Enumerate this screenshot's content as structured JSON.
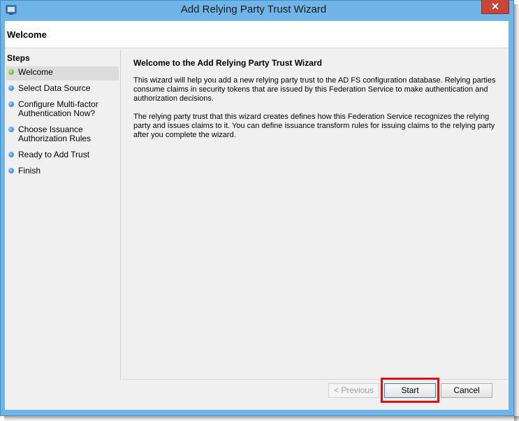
{
  "window": {
    "title": "Add Relying Party Trust Wizard",
    "close_glyph": "✕"
  },
  "header": {
    "title": "Welcome"
  },
  "steps": {
    "title": "Steps",
    "items": [
      {
        "label": "Welcome",
        "status": "current"
      },
      {
        "label": "Select Data Source",
        "status": "pending"
      },
      {
        "label": "Configure Multi-factor\nAuthentication Now?",
        "status": "pending"
      },
      {
        "label": "Choose Issuance\nAuthorization Rules",
        "status": "pending"
      },
      {
        "label": "Ready to Add Trust",
        "status": "pending"
      },
      {
        "label": "Finish",
        "status": "pending"
      }
    ]
  },
  "main": {
    "title": "Welcome to the Add Relying Party Trust Wizard",
    "paragraph1": "This wizard will help you add a new relying party trust to the AD FS configuration database.  Relying parties consume claims in security tokens that are issued by this Federation Service to make authentication and authorization decisions.",
    "paragraph2": "The relying party trust that this wizard creates defines how this Federation Service recognizes the relying party and issues claims to it. You can define issuance transform rules for issuing claims to the relying party after you complete the wizard."
  },
  "buttons": {
    "previous": "< Previous",
    "start": "Start",
    "cancel": "Cancel"
  },
  "colors": {
    "frame": "#6fb5e8",
    "highlight": "#e01010",
    "current_dot": "#3aa01c",
    "pending_dot": "#1565c8"
  }
}
